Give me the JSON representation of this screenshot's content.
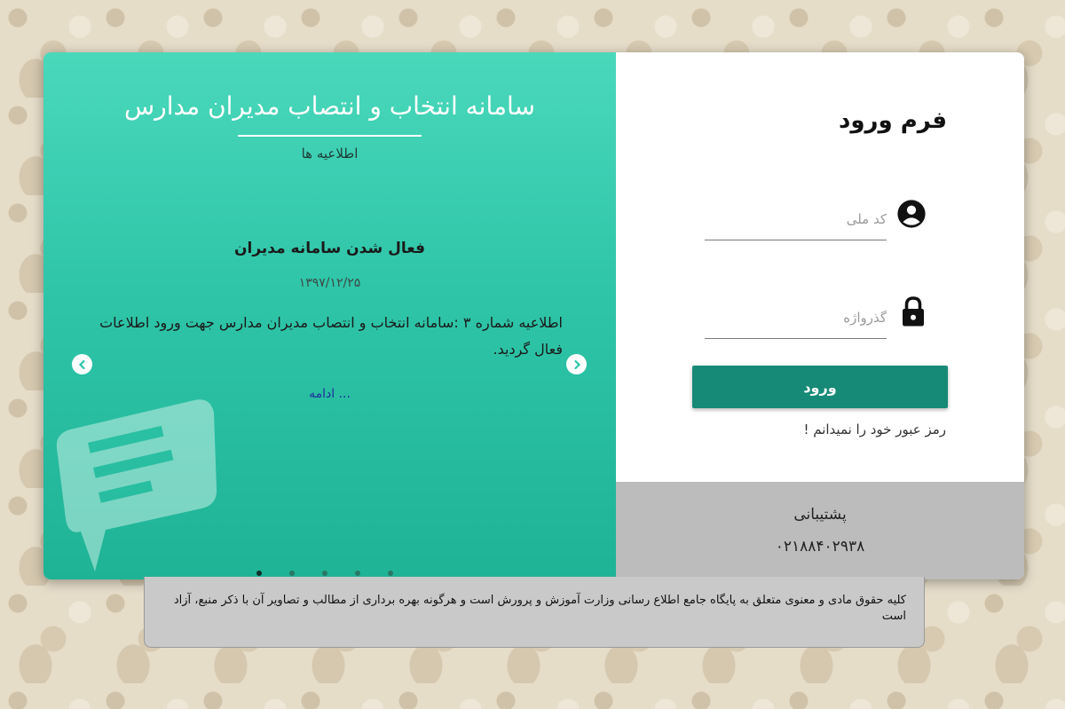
{
  "slider": {
    "title": "سامانه انتخاب و انتصاب مدیران مدارس",
    "subtitle": "اطلاعیه ها",
    "news": {
      "title": "فعال شدن سامانه مدیران",
      "date": "۱۳۹۷/۱۲/۲۵",
      "body": "اطلاعیه شماره ۳ :سامانه انتخاب و انتصاب مدیران مدارس جهت ورود اطلاعات فعال گردید.",
      "more": "... ادامه"
    },
    "dot_count": 5,
    "active_dot": 0
  },
  "login": {
    "title": "فرم ورود",
    "national_code_placeholder": "کد ملی",
    "password_placeholder": "گذرواژه",
    "submit_label": "ورود",
    "forgot_label": "رمز عبور خود را نمیدانم !"
  },
  "support": {
    "title": "پشتیبانی",
    "phone": "۰۲۱۸۸۴۰۲۹۳۸"
  },
  "footer": {
    "text": "کلیه حقوق مادی و معنوی متعلق به پایگاه جامع اطلاع رسانی وزارت آموزش و پرورش است و هرگونه بهره برداری از مطالب و تصاویر آن با ذکر منبع، آزاد است"
  },
  "colors": {
    "accent": "#168a76",
    "panel_green": "#2fc5a8",
    "support_bg": "#bcbcbc"
  }
}
